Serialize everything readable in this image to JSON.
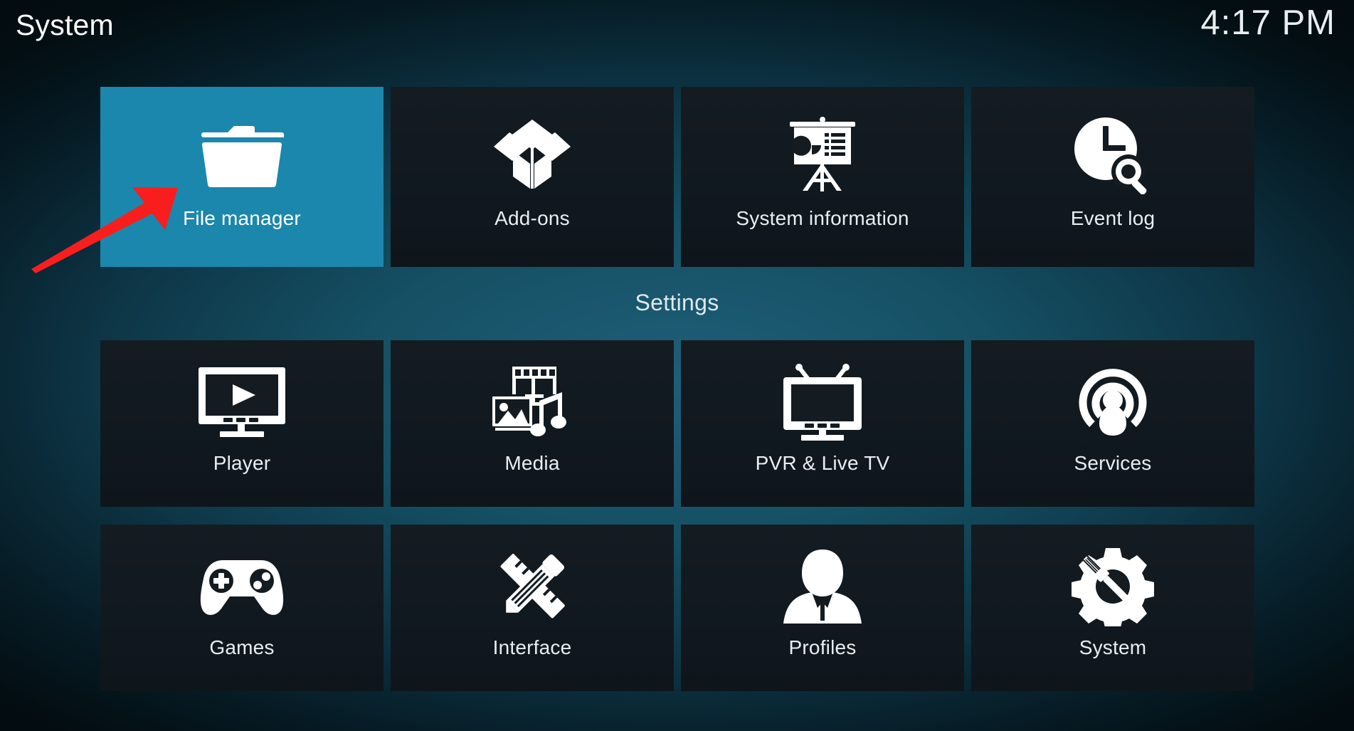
{
  "header": {
    "title": "System",
    "clock": "4:17 PM"
  },
  "section_label": "Settings",
  "colors": {
    "focus_tile": "#1b87ac",
    "tile_background": "#121a20",
    "background_center": "#1d5f78",
    "background_edge": "#04161c",
    "label_text": "#e9eef1",
    "annotation_arrow": "#f81e1e"
  },
  "top_row": {
    "items": [
      {
        "label": "File manager",
        "icon": "folder-icon",
        "focused": true
      },
      {
        "label": "Add-ons",
        "icon": "open-box-icon",
        "focused": false
      },
      {
        "label": "System information",
        "icon": "presentation-board-icon",
        "focused": false
      },
      {
        "label": "Event log",
        "icon": "clock-search-icon",
        "focused": false
      }
    ]
  },
  "settings_rows": [
    {
      "items": [
        {
          "label": "Player",
          "icon": "tv-play-icon",
          "focused": false
        },
        {
          "label": "Media",
          "icon": "media-mix-icon",
          "focused": false
        },
        {
          "label": "PVR & Live TV",
          "icon": "tv-antenna-icon",
          "focused": false
        },
        {
          "label": "Services",
          "icon": "broadcast-icon",
          "focused": false
        }
      ]
    },
    {
      "items": [
        {
          "label": "Games",
          "icon": "gamepad-icon",
          "focused": false
        },
        {
          "label": "Interface",
          "icon": "pencil-ruler-icon",
          "focused": false
        },
        {
          "label": "Profiles",
          "icon": "person-silhouette-icon",
          "focused": false
        },
        {
          "label": "System",
          "icon": "gear-screwdriver-icon",
          "focused": false
        }
      ]
    }
  ],
  "annotation": {
    "type": "arrow",
    "points_to": "File manager",
    "color": "#f81e1e"
  }
}
